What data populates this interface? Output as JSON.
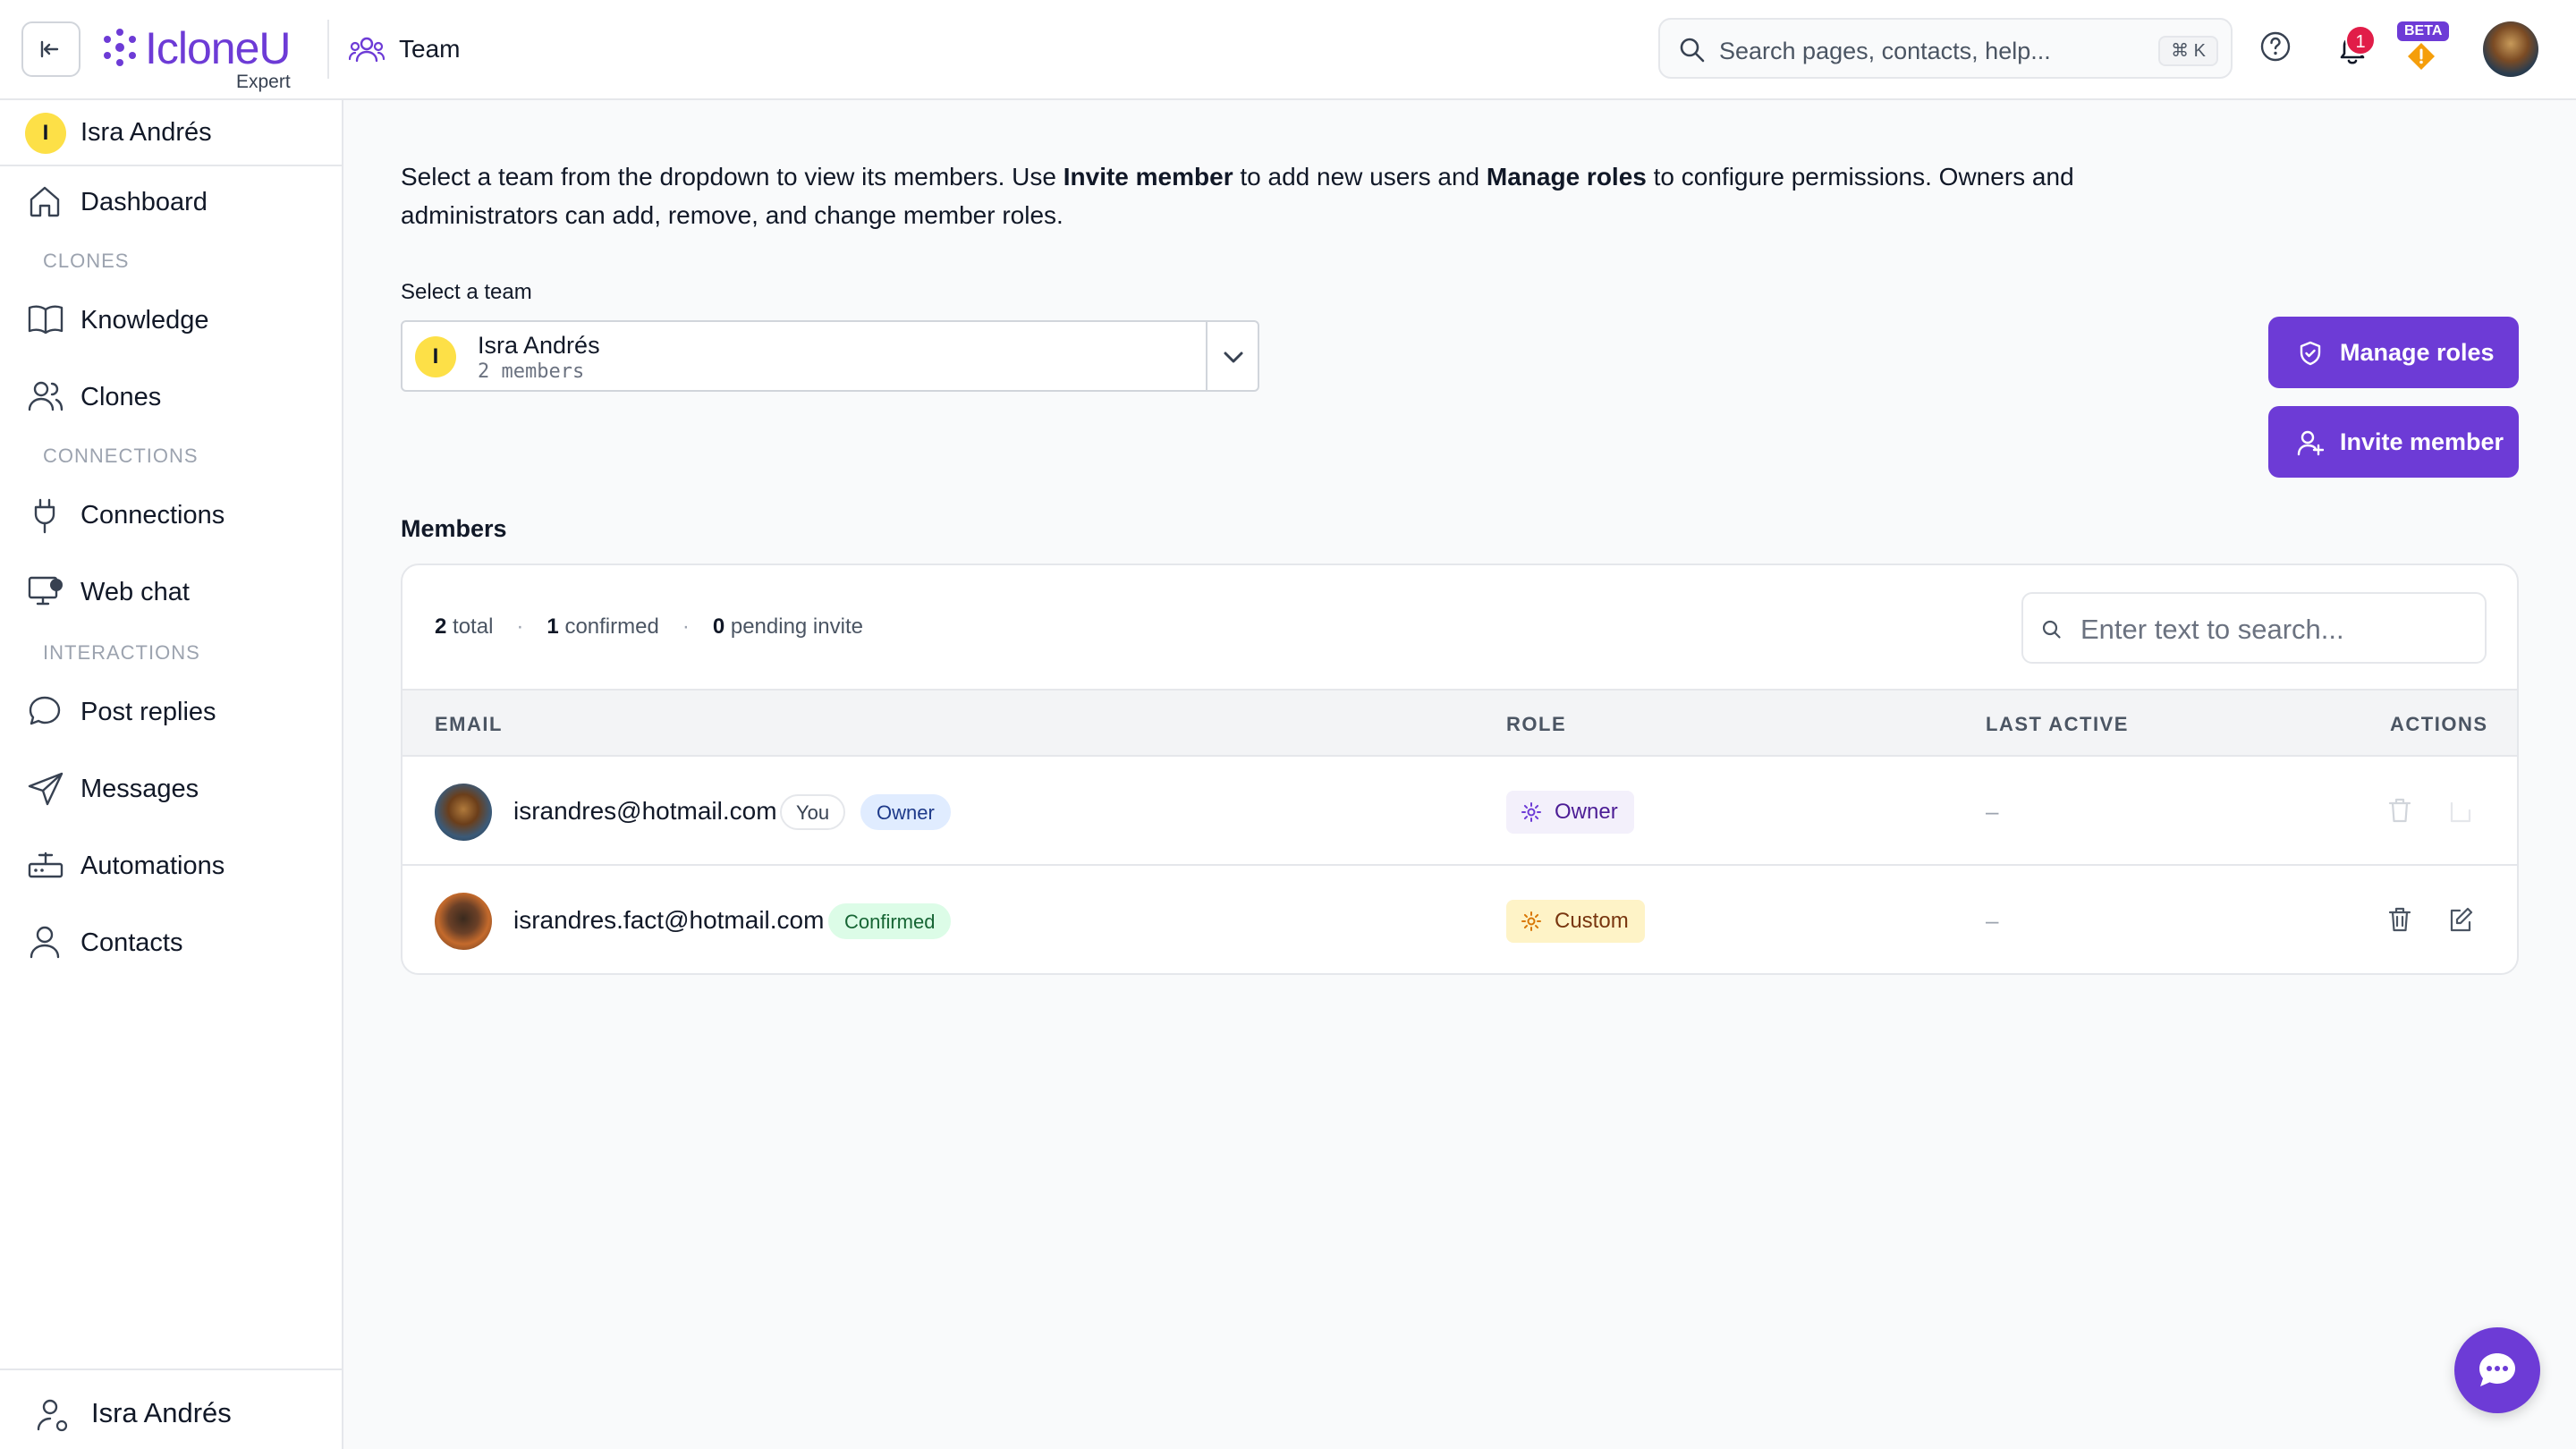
{
  "app": {
    "name": "IcloneU",
    "tier": "Expert"
  },
  "header": {
    "page_title": "Team",
    "search": {
      "placeholder": "Search pages, contacts, help...",
      "shortcut": "⌘ K"
    },
    "notifications_count": "1",
    "beta_label": "BETA"
  },
  "sidebar": {
    "team_switcher": {
      "initial": "I",
      "name": "Isra Andrés"
    },
    "items": {
      "dashboard": "Dashboard",
      "knowledge": "Knowledge",
      "clones": "Clones",
      "connections": "Connections",
      "webchat": "Web chat",
      "post_replies": "Post replies",
      "messages": "Messages",
      "automations": "Automations",
      "contacts": "Contacts"
    },
    "sections": {
      "clones": "CLONES",
      "connections": "CONNECTIONS",
      "interactions": "INTERACTIONS"
    },
    "footer_user": "Isra Andrés"
  },
  "main": {
    "intro": {
      "part1": "Select a team from the dropdown to view its members. Use ",
      "bold1": "Invite member",
      "part2": " to add new users and ",
      "bold2": "Manage roles",
      "part3": " to configure permissions. Owners and administrators can add, remove, and change member roles."
    },
    "select_label": "Select a team",
    "selected_team": {
      "initial": "I",
      "name": "Isra Andrés",
      "members": "2 members"
    },
    "buttons": {
      "manage_roles": "Manage roles",
      "invite_member": "Invite member"
    },
    "members_heading": "Members",
    "stats": {
      "total_num": "2",
      "total_label": "total",
      "confirmed_num": "1",
      "confirmed_label": "confirmed",
      "pending_num": "0",
      "pending_label": "pending invite",
      "separator": "·"
    },
    "table_search_placeholder": "Enter text to search...",
    "columns": {
      "email": "EMAIL",
      "role": "ROLE",
      "last_active": "LAST ACTIVE",
      "actions": "ACTIONS"
    },
    "rows": [
      {
        "email": "israndres@hotmail.com",
        "badges": [
          "You",
          "Owner"
        ],
        "role": "Owner",
        "last_active": "–"
      },
      {
        "email": "israndres.fact@hotmail.com",
        "badges": [
          "Confirmed"
        ],
        "role": "Custom",
        "last_active": "–"
      }
    ]
  },
  "colors": {
    "brand": "#6d3bd6",
    "notification_badge": "#e11d48",
    "warning": "#f59e0b",
    "avatar_yellow": "#fde047"
  }
}
